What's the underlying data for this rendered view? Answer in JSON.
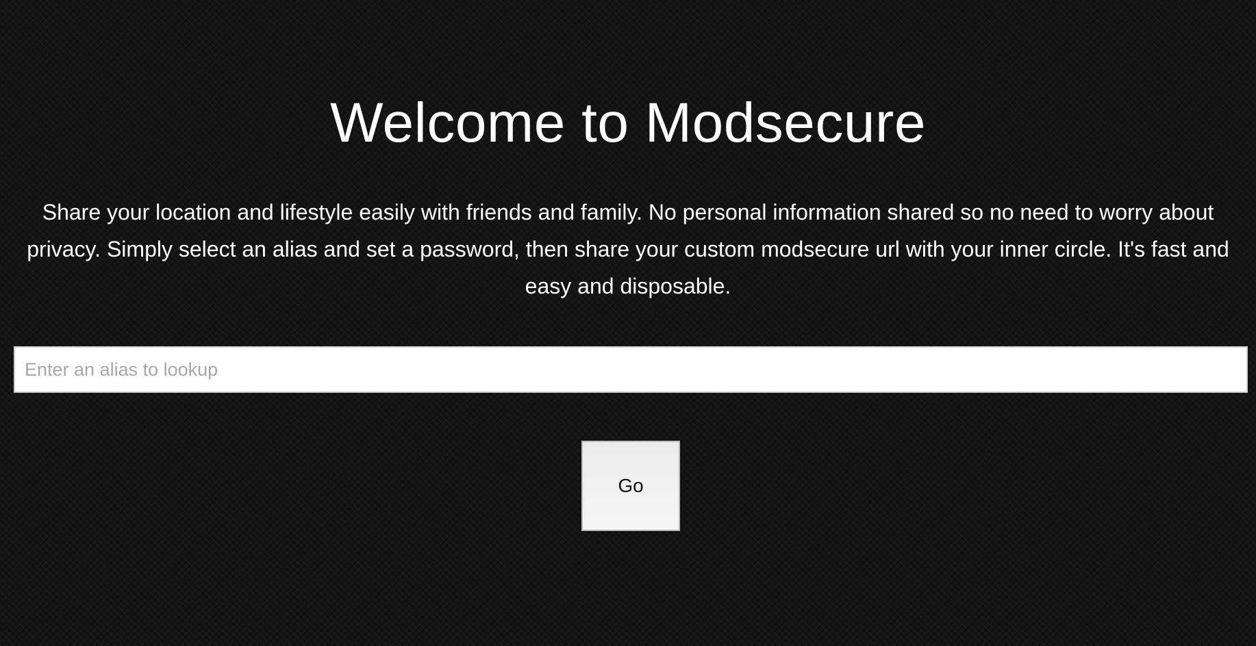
{
  "page": {
    "title": "Welcome to Modsecure",
    "description": "Share your location and lifestyle easily with friends and family. No personal information shared so no need to worry about privacy. Simply select an alias and set a password, then share your custom modsecure url with your inner circle. It's fast and easy and disposable."
  },
  "lookup": {
    "placeholder": "Enter an alias to lookup",
    "value": "",
    "button_label": "Go"
  },
  "colors": {
    "background": "#141414",
    "text": "#ffffff",
    "input_background": "#ffffff",
    "button_background": "#eeeeee"
  }
}
